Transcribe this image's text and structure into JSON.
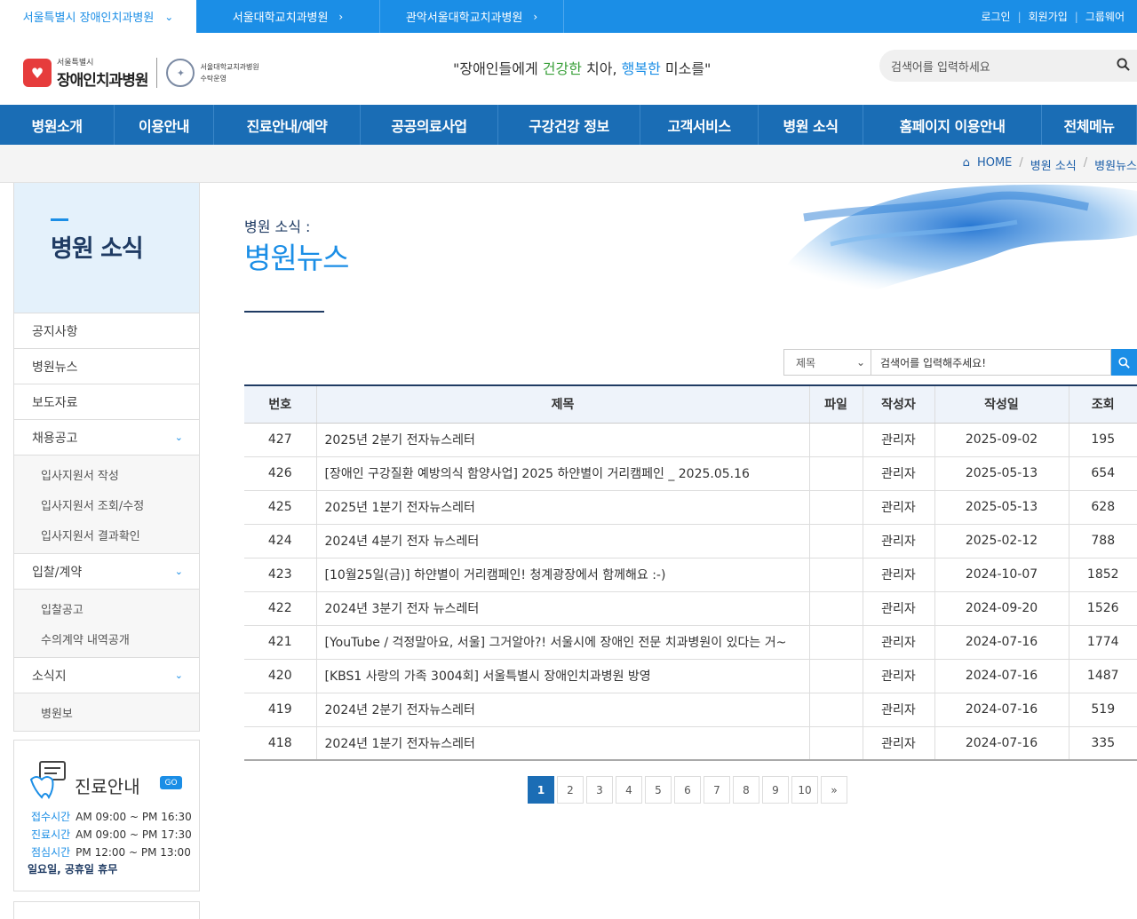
{
  "topbar": {
    "sites": [
      {
        "label": "서울특별시 장애인치과병원"
      },
      {
        "label": "서울대학교치과병원"
      },
      {
        "label": "관악서울대학교치과병원"
      }
    ],
    "links": [
      "로그인",
      "회원가입",
      "그룹웨어"
    ]
  },
  "header": {
    "logo_small": "서울특별시",
    "logo_big": "장애인치과병원",
    "logo_heart": "서울케어",
    "partner_line1": "서울대학교치과병원",
    "partner_line2": "수탁운영",
    "slogan_q1": "\"장애인들에게 ",
    "slogan_g": "건강한",
    "slogan_mid": " 치아, ",
    "slogan_b": "행복한",
    "slogan_end": " 미소를\"",
    "search_placeholder": "검색어를 입력하세요"
  },
  "gnb": [
    {
      "label": "병원소개",
      "w": 129
    },
    {
      "label": "이용안내",
      "w": 112
    },
    {
      "label": "진료안내/예약",
      "w": 165
    },
    {
      "label": "공공의료사업",
      "w": 155
    },
    {
      "label": "구강건강 정보",
      "w": 160
    },
    {
      "label": "고객서비스",
      "w": 133
    },
    {
      "label": "병원 소식",
      "w": 118
    },
    {
      "label": "홈페이지 이용안내",
      "w": 201
    },
    {
      "label": "전체메뉴",
      "w": 107
    }
  ],
  "breadcrumb": [
    "HOME",
    "병원 소식",
    "병원뉴스"
  ],
  "sidebar": {
    "title": "병원 소식",
    "menu": [
      {
        "label": "공지사항",
        "expandable": false
      },
      {
        "label": "병원뉴스",
        "expandable": false
      },
      {
        "label": "보도자료",
        "expandable": false
      },
      {
        "label": "채용공고",
        "expandable": true,
        "sub": [
          "입사지원서 작성",
          "입사지원서 조회/수정",
          "입사지원서 결과확인"
        ]
      },
      {
        "label": "입찰/계약",
        "expandable": true,
        "sub": [
          "입찰공고",
          "수의계약 내역공개"
        ]
      },
      {
        "label": "소식지",
        "expandable": true,
        "sub": [
          "병원보"
        ]
      }
    ],
    "clinic": {
      "title": "진료안내",
      "go": "GO",
      "rows": [
        {
          "k": "접수시간",
          "v": "AM 09:00 ~ PM 16:30"
        },
        {
          "k": "진료시간",
          "v": "AM 09:00 ~ PM 17:30"
        },
        {
          "k": "점심시간",
          "v": "PM 12:00 ~ PM 13:00"
        }
      ],
      "holiday": "일요일, 공휴일 휴무"
    }
  },
  "page": {
    "subtitle": "병원 소식 :",
    "title": "병원뉴스"
  },
  "board_search": {
    "select_value": "제목",
    "placeholder": "검색어를 입력해주세요!"
  },
  "table": {
    "headers": [
      "번호",
      "제목",
      "파일",
      "작성자",
      "작성일",
      "조회"
    ],
    "rows": [
      [
        "427",
        "2025년 2분기 전자뉴스레터",
        "",
        "관리자",
        "2025-09-02",
        "195"
      ],
      [
        "426",
        "[장애인 구강질환 예방의식 함양사업] 2025 하얀별이 거리캠페인 _ 2025.05.16",
        "",
        "관리자",
        "2025-05-13",
        "654"
      ],
      [
        "425",
        "2025년 1분기 전자뉴스레터",
        "",
        "관리자",
        "2025-05-13",
        "628"
      ],
      [
        "424",
        "2024년 4분기 전자 뉴스레터",
        "",
        "관리자",
        "2025-02-12",
        "788"
      ],
      [
        "423",
        "[10월25일(금)] 하얀별이 거리캠페인! 청계광장에서 함께해요 :-)",
        "",
        "관리자",
        "2024-10-07",
        "1852"
      ],
      [
        "422",
        "2024년 3분기 전자 뉴스레터",
        "",
        "관리자",
        "2024-09-20",
        "1526"
      ],
      [
        "421",
        "[YouTube / 걱정말아요, 서울] 그거알아?! 서울시에 장애인 전문 치과병원이 있다는 거~",
        "",
        "관리자",
        "2024-07-16",
        "1774"
      ],
      [
        "420",
        "[KBS1 사랑의 가족 3004회] 서울특별시 장애인치과병원 방영",
        "",
        "관리자",
        "2024-07-16",
        "1487"
      ],
      [
        "419",
        "2024년 2분기 전자뉴스레터",
        "",
        "관리자",
        "2024-07-16",
        "519"
      ],
      [
        "418",
        "2024년 1분기 전자뉴스레터",
        "",
        "관리자",
        "2024-07-16",
        "335"
      ]
    ]
  },
  "pagination": {
    "pages": [
      "1",
      "2",
      "3",
      "4",
      "5",
      "6",
      "7",
      "8",
      "9",
      "10"
    ],
    "current": "1",
    "next": "»"
  },
  "colors": {
    "primary": "#1b8ee6",
    "nav": "#1a6db5",
    "navy": "#1f3b63"
  }
}
